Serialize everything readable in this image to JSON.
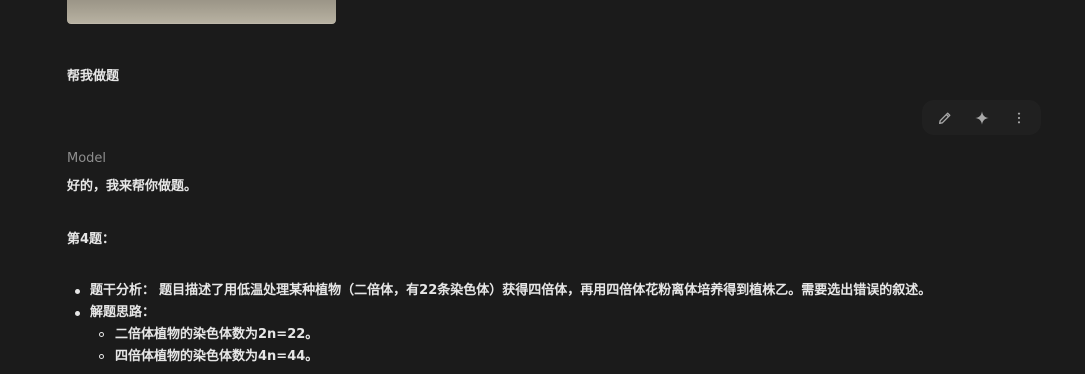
{
  "attachment": {
    "icon": "image-thumbnail"
  },
  "user": {
    "prompt": "帮我做题"
  },
  "actions": {
    "edit_icon": "pencil-icon",
    "sparkle_icon": "sparkle-icon",
    "more_icon": "more-vert-icon"
  },
  "model": {
    "label": "Model",
    "intro": "好的，我来帮你做题。",
    "question_heading": "第4题：",
    "bullets": [
      {
        "label": "题干分析：",
        "text": "题目描述了用低温处理某种植物（二倍体，有22条染色体）获得四倍体，再用四倍体花粉离体培养得到植株乙。需要选出错误的叙述。"
      },
      {
        "label": "解题思路：",
        "sub": [
          "二倍体植物的染色体数为2n=22。",
          "四倍体植物的染色体数为4n=44。"
        ]
      }
    ]
  }
}
